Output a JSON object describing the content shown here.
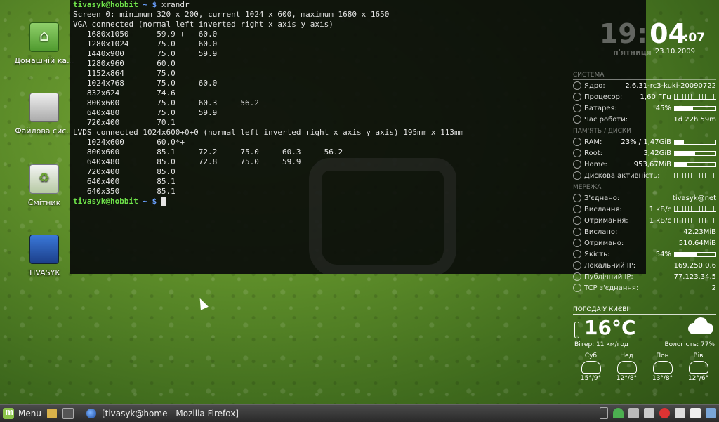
{
  "desktop_icons": [
    {
      "label": "Домашній ка..."
    },
    {
      "label": "Файлова сис..."
    },
    {
      "label": "Смітник"
    },
    {
      "label": "TIVASYK"
    }
  ],
  "terminal": {
    "prompt_user": "tivasyk@hobbit",
    "prompt_path": " ~ $ ",
    "command": "xrandr",
    "output": [
      "Screen 0: minimum 320 x 200, current 1024 x 600, maximum 1680 x 1650",
      "VGA connected (normal left inverted right x axis y axis)",
      "   1680x1050      59.9 +   60.0",
      "   1280x1024      75.0     60.0",
      "   1440x900       75.0     59.9",
      "   1280x960       60.0",
      "   1152x864       75.0",
      "   1024x768       75.0     60.0",
      "   832x624        74.6",
      "   800x600        75.0     60.3     56.2",
      "   640x480        75.0     59.9",
      "   720x400        70.1",
      "LVDS connected 1024x600+0+0 (normal left inverted right x axis y axis) 195mm x 113mm",
      "   1024x600       60.0*+",
      "   800x600        85.1     72.2     75.0     60.3     56.2",
      "   640x480        85.0     72.8     75.0     59.9",
      "   720x400        85.0",
      "   640x400        85.1",
      "   640x350        85.1"
    ]
  },
  "clock": {
    "hour": "19:",
    "minute": "04",
    "second": ":07",
    "weekday": "п'ятниця",
    "date": "23.10.2009"
  },
  "conky": {
    "system_title": "СИСТЕМА",
    "system": [
      {
        "label": "Ядро:",
        "value": "2.6.31-rc3-kuki-20090722"
      },
      {
        "label": "Процесор:",
        "value": "1,60 ГГц",
        "graph": true
      },
      {
        "label": "Батарея:",
        "value": "45%",
        "bar": 0.45
      },
      {
        "label": "Час роботи:",
        "value": "1d 22h 59m"
      }
    ],
    "memory_title": "ПАМ'ЯТЬ / ДИСКИ",
    "memory": [
      {
        "label": "RAM:",
        "value": "23% / 1,47GiB",
        "bar": 0.23
      },
      {
        "label": "Root:",
        "value": "3,42GiB",
        "bar": 0.5
      },
      {
        "label": "Home:",
        "value": "953,67MiB",
        "bar": 0.3
      },
      {
        "label": "Дискова активність:",
        "value": "",
        "graph": true
      }
    ],
    "network_title": "МЕРЕЖА",
    "network": [
      {
        "label": "З'єднано:",
        "value": "tivasyk@net"
      },
      {
        "label": "Вислання:",
        "value": "1 кБ/с",
        "graph": true
      },
      {
        "label": "Отримання:",
        "value": "1 кБ/с",
        "graph": true
      },
      {
        "label": "Вислано:",
        "value": "42.23MiB"
      },
      {
        "label": "Отримано:",
        "value": "510.64MiB"
      },
      {
        "label": "Якість:",
        "value": "54%",
        "bar": 0.54
      },
      {
        "label": "Локальний IP:",
        "value": "169.250.0.6"
      },
      {
        "label": "Публічний IP:",
        "value": "77.123.34.5"
      },
      {
        "label": "TCP з'єднання:",
        "value": "2"
      }
    ]
  },
  "weather": {
    "title": "ПОГОДА У КИЄВІ",
    "temperature": "16°C",
    "wind": "Вітер:  11 км/год",
    "humidity": "Вологість:  77%",
    "forecast": [
      {
        "day": "Суб",
        "temps": "15°/9°"
      },
      {
        "day": "Нед",
        "temps": "12°/8°"
      },
      {
        "day": "Пон",
        "temps": "13°/8°"
      },
      {
        "day": "Вів",
        "temps": "12°/6°"
      }
    ]
  },
  "taskbar": {
    "menu_label": "Menu",
    "task_label": "[tivasyk@home - Mozilla Firefox]"
  }
}
